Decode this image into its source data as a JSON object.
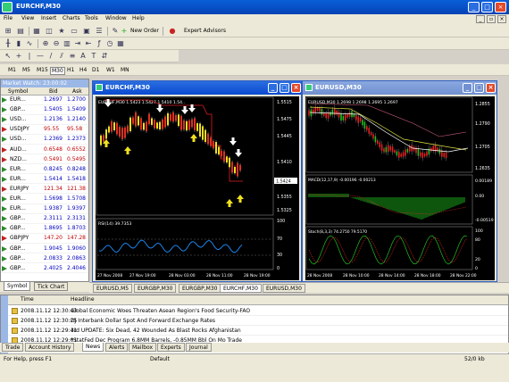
{
  "app": {
    "title": "EURCHF,M30"
  },
  "menu": [
    "File",
    "View",
    "Insert",
    "Charts",
    "Tools",
    "Window",
    "Help"
  ],
  "toolbar": {
    "new_order": "New Order",
    "expert_advisors": "Expert Advisors"
  },
  "timeframes": [
    "M1",
    "M5",
    "M15",
    "M30",
    "H1",
    "H4",
    "D1",
    "W1",
    "MN"
  ],
  "active_timeframe": "M30",
  "market_watch": {
    "title": "Market Watch: 23:00:02",
    "headers": {
      "symbol": "Symbol",
      "bid": "Bid",
      "ask": "Ask"
    },
    "rows": [
      {
        "symbol": "EUR...",
        "bid": "1.2697",
        "ask": "1.2700",
        "color": "#0000c0"
      },
      {
        "symbol": "GBP...",
        "bid": "1.5405",
        "ask": "1.5409",
        "color": "#0000c0"
      },
      {
        "symbol": "USD...",
        "bid": "1.2136",
        "ask": "1.2140",
        "color": "#0000c0"
      },
      {
        "symbol": "USDJPY",
        "bid": "95.55",
        "ask": "95.58",
        "color": "#c00000"
      },
      {
        "symbol": "USD...",
        "bid": "1.2369",
        "ask": "1.2373",
        "color": "#0000c0"
      },
      {
        "symbol": "AUD...",
        "bid": "0.6548",
        "ask": "0.6552",
        "color": "#c00000"
      },
      {
        "symbol": "NZD...",
        "bid": "0.5491",
        "ask": "0.5495",
        "color": "#c00000"
      },
      {
        "symbol": "EUR...",
        "bid": "0.8245",
        "ask": "0.8248",
        "color": "#0000c0"
      },
      {
        "symbol": "EUR...",
        "bid": "1.5414",
        "ask": "1.5418",
        "color": "#0000c0"
      },
      {
        "symbol": "EURJPY",
        "bid": "121.34",
        "ask": "121.38",
        "color": "#c00000"
      },
      {
        "symbol": "EUR...",
        "bid": "1.5698",
        "ask": "1.5708",
        "color": "#0000c0"
      },
      {
        "symbol": "EUR...",
        "bid": "1.9387",
        "ask": "1.9397",
        "color": "#0000c0"
      },
      {
        "symbol": "GBP...",
        "bid": "2.3111",
        "ask": "2.3131",
        "color": "#0000c0"
      },
      {
        "symbol": "GBP...",
        "bid": "1.8695",
        "ask": "1.8703",
        "color": "#0000c0"
      },
      {
        "symbol": "GBPJPY",
        "bid": "147.20",
        "ask": "147.28",
        "color": "#c00000"
      },
      {
        "symbol": "GBP...",
        "bid": "1.9045",
        "ask": "1.9060",
        "color": "#0000c0"
      },
      {
        "symbol": "GBP...",
        "bid": "2.0833",
        "ask": "2.0863",
        "color": "#0000c0"
      },
      {
        "symbol": "GBP...",
        "bid": "2.4025",
        "ask": "2.4046",
        "color": "#0000c0"
      }
    ],
    "tabs": [
      "Symbol",
      "Tick Chart"
    ]
  },
  "chart1": {
    "title": "EURCHF,M30",
    "header": "EURCHF,M30  1.5423  1.5427  1.5410  1.54..",
    "prices": [
      "1.5515",
      "1.5475",
      "1.5445",
      "1.5410",
      "1.5385",
      "1.5355",
      "1.5325"
    ],
    "current": "1.5424",
    "rsi_label": "RSI(14) 39.7353",
    "rsi_levels": [
      "100",
      "70",
      "30",
      "0"
    ],
    "dates": [
      "27 Nov 2008",
      "27 Nov 19:00",
      "28 Nov 03:00",
      "28 Nov 11:00",
      "28 Nov 19:00"
    ]
  },
  "chart2": {
    "title": "EURUSD,M30",
    "header": "EURUSD,M30  1.2698  1.2698  1.2695  1.2697",
    "prices": [
      "1.2855",
      "1.2790",
      "1.2705",
      "1.2635"
    ],
    "macd_label": "MACD(12,17,9) -0.00196 -0.00213",
    "macd_levels": [
      "0.00189",
      "0.00",
      "-0.00519"
    ],
    "stoch_label": "Stoch(8,3,3) 74.2750 79.5170",
    "stoch_levels": [
      "100",
      "80",
      "20",
      "0"
    ],
    "dates": [
      "28 Nov 2008",
      "28 Nov 10:00",
      "28 Nov 14:00",
      "28 Nov 18:00",
      "28 Nov 22:00"
    ]
  },
  "chart_tabs": [
    "EURUSD,M5",
    "EURGBP,M30",
    "EURGBP,M30",
    "EURCHF,M30",
    "EURUSD,M30"
  ],
  "active_chart_tab": 3,
  "terminal": {
    "side_label": "Terminal",
    "headers": {
      "time": "Time",
      "headline": "Headline"
    },
    "rows": [
      {
        "time": "2008.11.12 12:30:43",
        "headline": "Global Economic Woes Threaten Asean Region's Food Security-FAO"
      },
      {
        "time": "2008.11.12 12:30:25",
        "headline": "DJ Interbank Dollar Spot And Forward Exchange Rates"
      },
      {
        "time": "2008.11.12 12:29:41",
        "headline": "3rd UPDATE: Six Dead, 42 Wounded As Blast Rocks Afghanistan"
      },
      {
        "time": "2008.11.12 12:29:01",
        "headline": "*StatFed Dec Program 6.8MM Barrels, -0.85MM Bbl On Mo Trade"
      }
    ],
    "tabs": [
      "Trade",
      "Account History",
      "News",
      "Alerts",
      "Mailbox",
      "Experts",
      "Journal"
    ],
    "active_tab": 2
  },
  "status": {
    "help": "For Help, press F1",
    "profile": "Default",
    "traffic": "52/0 kb"
  }
}
